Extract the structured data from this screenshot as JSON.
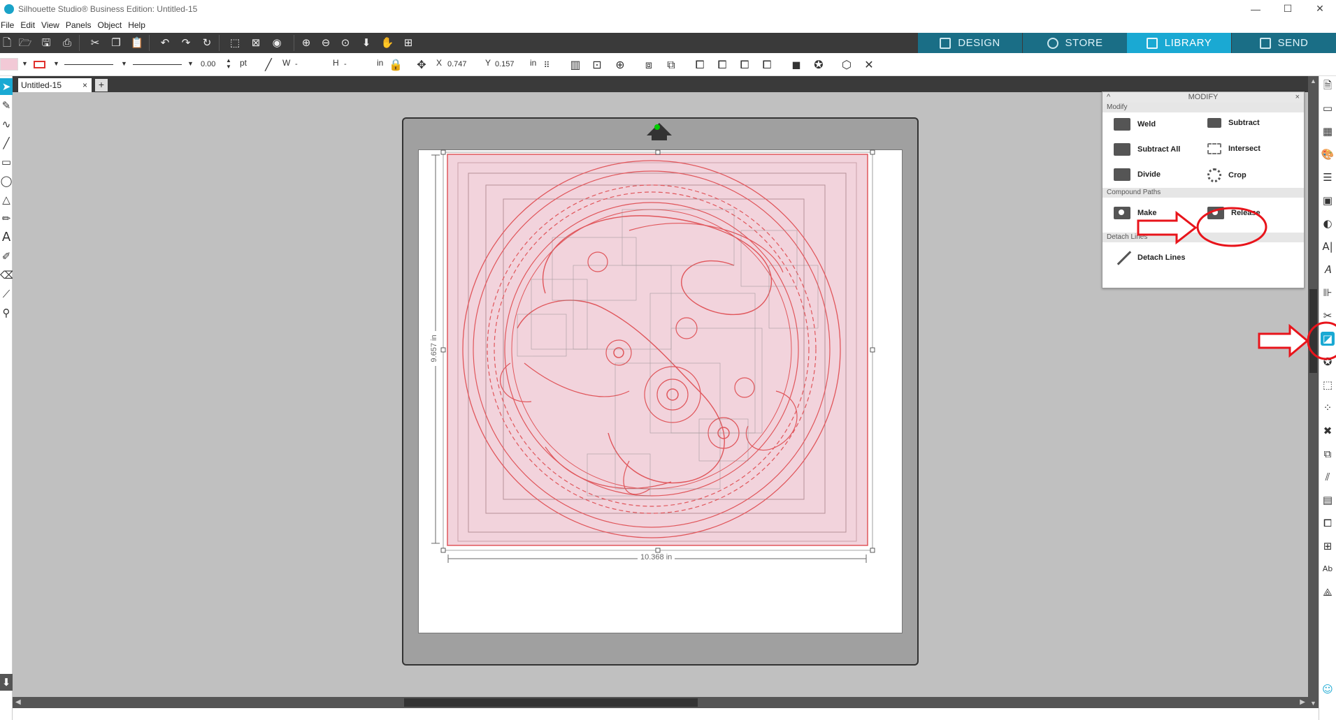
{
  "window": {
    "title": "Silhouette Studio® Business Edition: Untitled-15",
    "minimize": "—",
    "maximize": "☐",
    "close": "✕"
  },
  "menu": [
    "File",
    "Edit",
    "View",
    "Panels",
    "Object",
    "Help"
  ],
  "nav_tabs": [
    {
      "label": "DESIGN",
      "active": false
    },
    {
      "label": "STORE",
      "active": false
    },
    {
      "label": "LIBRARY",
      "active": true
    },
    {
      "label": "SEND",
      "active": false
    }
  ],
  "properties": {
    "line_width": "0.00",
    "line_unit": "pt",
    "w_label": "W",
    "w_value": "-",
    "h_label": "H",
    "h_value": "-",
    "size_unit": "in",
    "x_label": "X",
    "x_value": "0.747",
    "y_label": "Y",
    "y_value": "0.157",
    "pos_unit": "in"
  },
  "document": {
    "tab_name": "Untitled-15",
    "tab_close": "×",
    "add_tab": "+"
  },
  "canvas": {
    "width_label": "10.368 in",
    "height_label": "9.657 in"
  },
  "modify_panel": {
    "title": "MODIFY",
    "collapse": "^",
    "close": "×",
    "sections": [
      {
        "name": "Modify",
        "items": [
          "Weld",
          "Subtract",
          "Subtract All",
          "Intersect",
          "Divide",
          "Crop"
        ]
      },
      {
        "name": "Compound Paths",
        "items": [
          "Make",
          "Release"
        ]
      },
      {
        "name": "Detach Lines",
        "items": [
          "Detach Lines"
        ]
      }
    ]
  },
  "annotation_colors": {
    "arrow": "#e8141b",
    "accent": "#1aa9d3",
    "design_line": "#e0565b",
    "design_fill": "#f2d3dc"
  }
}
